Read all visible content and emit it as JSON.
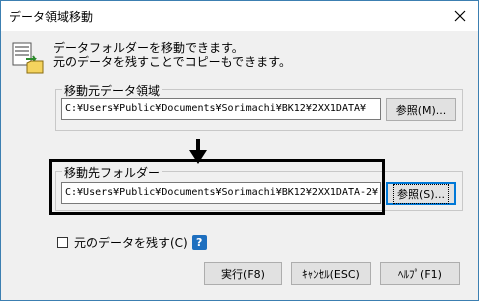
{
  "window": {
    "title": "データ領域移動",
    "close_label": "✕"
  },
  "message": {
    "line1": "データフォルダーを移動できます。",
    "line2": "元のデータを残すことでコピーもできます。"
  },
  "source": {
    "group_label": "移動元データ領域",
    "path": "C:¥Users¥Public¥Documents¥Sorimachi¥BK12¥2XX1DATA¥",
    "browse_label": "参照(M)..."
  },
  "destination": {
    "group_label": "移動先フォルダー",
    "path": "C:¥Users¥Public¥Documents¥Sorimachi¥BK12¥2XX1DATA-2¥",
    "browse_label": "参照(S)..."
  },
  "keep_original": {
    "label": "元のデータを残す(C)",
    "checked": false,
    "help_glyph": "?"
  },
  "buttons": {
    "execute": "実行(F8)",
    "cancel": "ｷｬﾝｾﾙ(ESC)",
    "help": "ﾍﾙﾌﾟ(F1)"
  },
  "colors": {
    "window_border": "#3c7fb1",
    "dialog_bg": "#f0f0f0",
    "focus_blue": "#0078d7",
    "help_badge": "#1e6fbf"
  }
}
